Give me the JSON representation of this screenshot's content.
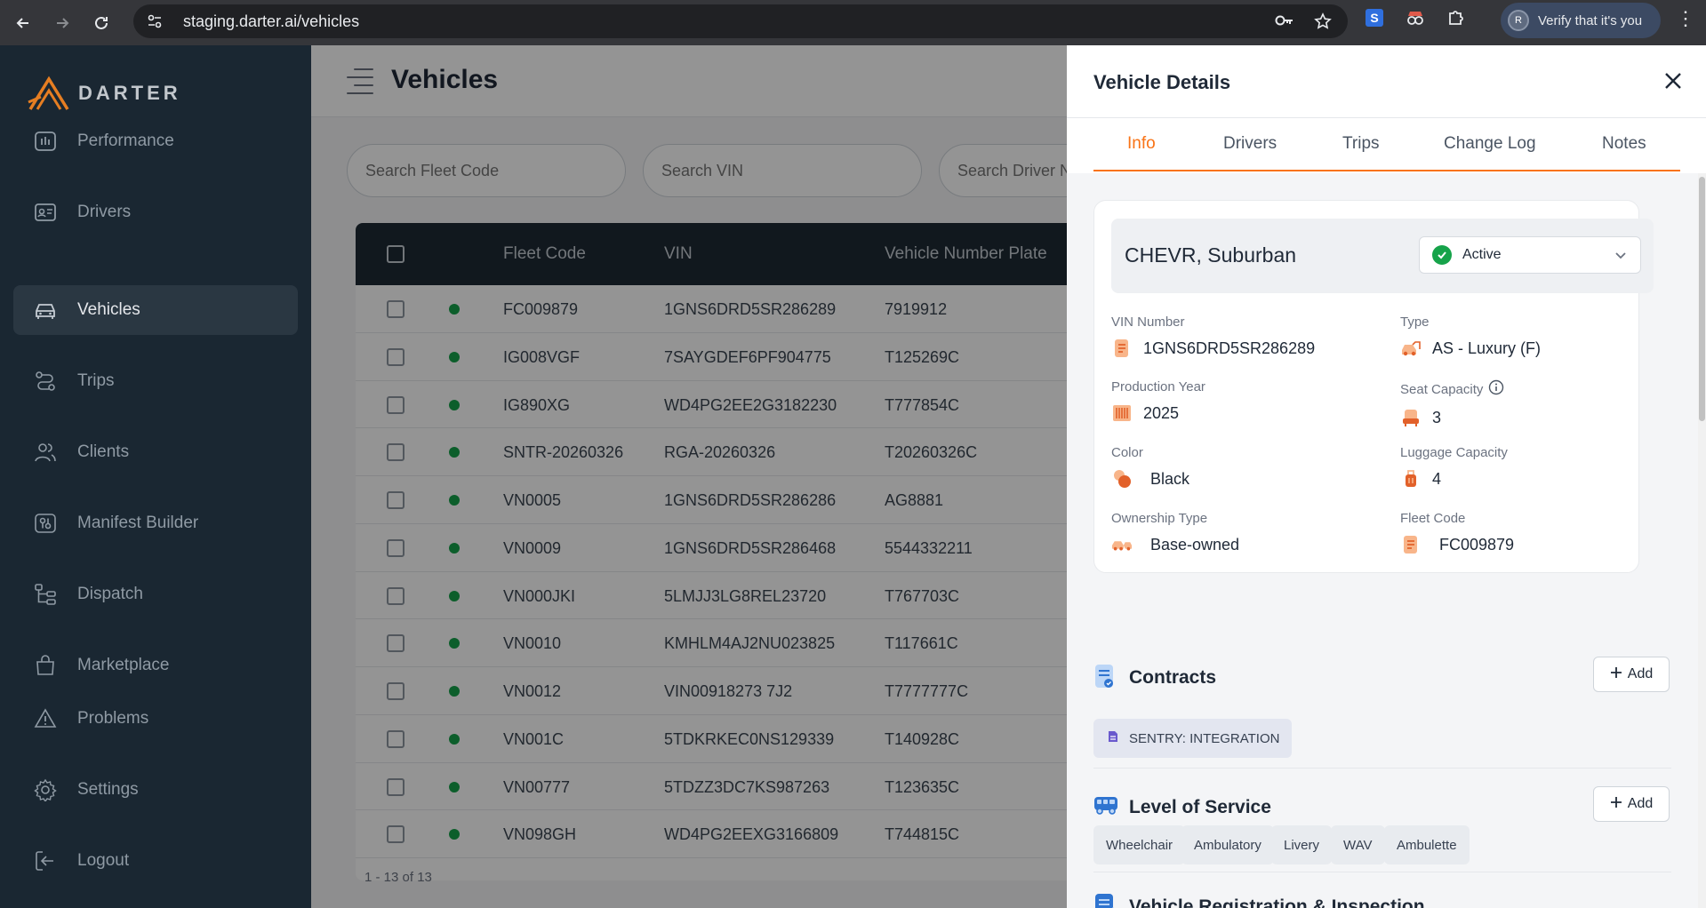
{
  "browser": {
    "url": "staging.darter.ai/vehicles",
    "profile_label": "Verify that it's you",
    "profile_initial": "R"
  },
  "sidebar": {
    "brand": "DARTER",
    "items": [
      {
        "label": "Performance",
        "icon": "performance-icon"
      },
      {
        "label": "Drivers",
        "icon": "id-card-icon"
      },
      {
        "label": "Vehicles",
        "icon": "car-icon",
        "active": true
      },
      {
        "label": "Trips",
        "icon": "route-icon"
      },
      {
        "label": "Clients",
        "icon": "users-icon"
      },
      {
        "label": "Manifest Builder",
        "icon": "manifest-icon"
      },
      {
        "label": "Dispatch",
        "icon": "dispatch-icon"
      },
      {
        "label": "Marketplace",
        "icon": "bag-icon"
      },
      {
        "label": "Problems",
        "icon": "warning-icon"
      },
      {
        "label": "Settings",
        "icon": "gear-icon"
      },
      {
        "label": "Logout",
        "icon": "logout-icon"
      }
    ]
  },
  "main": {
    "title": "Vehicles",
    "search": {
      "fleet_code_placeholder": "Search Fleet Code",
      "vin_placeholder": "Search VIN",
      "driver_placeholder": "Search Driver N"
    },
    "table": {
      "columns": [
        "Fleet Code",
        "VIN",
        "Vehicle Number Plate"
      ],
      "rows": [
        {
          "fleet_code": "FC009879",
          "vin": "1GNS6DRD5SR286289",
          "plate": "7919912"
        },
        {
          "fleet_code": "IG008VGF",
          "vin": "7SAYGDEF6PF904775",
          "plate": "T125269C"
        },
        {
          "fleet_code": "IG890XG",
          "vin": "WD4PG2EE2G3182230",
          "plate": "T777854C"
        },
        {
          "fleet_code": "SNTR-20260326",
          "vin": "RGA-20260326",
          "plate": "T20260326C"
        },
        {
          "fleet_code": "VN0005",
          "vin": "1GNS6DRD5SR286286",
          "plate": "AG8881"
        },
        {
          "fleet_code": "VN0009",
          "vin": "1GNS6DRD5SR286468",
          "plate": "5544332211"
        },
        {
          "fleet_code": "VN000JKI",
          "vin": "5LMJJ3LG8REL23720",
          "plate": "T767703C"
        },
        {
          "fleet_code": "VN0010",
          "vin": "KMHLM4AJ2NU023825",
          "plate": "T117661C"
        },
        {
          "fleet_code": "VN0012",
          "vin": "VIN00918273 7J2",
          "plate": "T7777777C"
        },
        {
          "fleet_code": "VN001C",
          "vin": "5TDKRKEC0NS129339",
          "plate": "T140928C"
        },
        {
          "fleet_code": "VN00777",
          "vin": "5TDZZ3DC7KS987263",
          "plate": "T123635C"
        },
        {
          "fleet_code": "VN098GH",
          "vin": "WD4PG2EEXG3166809",
          "plate": "T744815C"
        }
      ]
    },
    "pagination": "1 - 13 of 13"
  },
  "panel": {
    "title": "Vehicle Details",
    "tabs": [
      "Info",
      "Drivers",
      "Trips",
      "Change Log",
      "Notes"
    ],
    "vehicle_name": "CHEVR, Suburban",
    "status": "Active",
    "fields": {
      "vin_label": "VIN Number",
      "vin_value": "1GNS6DRD5SR286289",
      "type_label": "Type",
      "type_value": "AS - Luxury (F)",
      "year_label": "Production Year",
      "year_value": "2025",
      "seat_label": "Seat Capacity",
      "seat_value": "3",
      "color_label": "Color",
      "color_value": "Black",
      "luggage_label": "Luggage Capacity",
      "luggage_value": "4",
      "ownership_label": "Ownership Type",
      "ownership_value": "Base-owned",
      "fleet_label": "Fleet Code",
      "fleet_value": "FC009879"
    },
    "contracts": {
      "title": "Contracts",
      "add_label": "Add",
      "items": [
        "SENTRY: INTEGRATION"
      ]
    },
    "level_of_service": {
      "title": "Level of Service",
      "add_label": "Add",
      "items": [
        "Wheelchair",
        "Ambulatory",
        "Livery",
        "WAV",
        "Ambulette"
      ]
    },
    "registration": {
      "title": "Vehicle Registration & Inspection"
    }
  },
  "colors": {
    "accent": "#f97316",
    "sidebar_bg": "#1a2732",
    "table_header_bg": "#1e2a35",
    "status_green": "#16a34a"
  }
}
